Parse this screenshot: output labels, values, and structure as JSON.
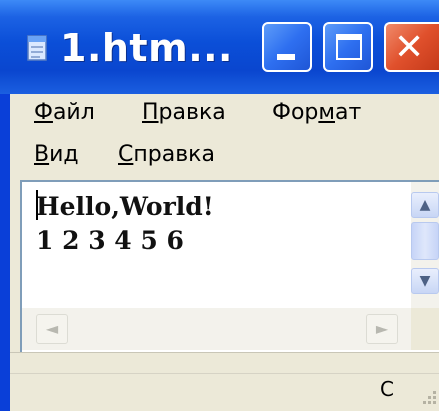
{
  "window": {
    "title": "1.htm...",
    "icon": "notepad-icon",
    "controls": {
      "minimize": "minimize-icon",
      "maximize": "maximize-icon",
      "close": "close-icon"
    }
  },
  "menu": {
    "items": [
      {
        "pre": "",
        "key": "Ф",
        "post": "айл"
      },
      {
        "pre": "",
        "key": "П",
        "post": "равка"
      },
      {
        "pre": "Фор",
        "key": "м",
        "post": "ат"
      },
      {
        "pre": "",
        "key": "В",
        "post": "ид"
      },
      {
        "pre": "",
        "key": "С",
        "post": "правка"
      }
    ]
  },
  "editor": {
    "lines": [
      "Hello,World!",
      "1 2 3 4 5 6"
    ]
  },
  "scrollbars": {
    "up": "▲",
    "down": "▼",
    "left": "◄",
    "right": "►"
  },
  "status": {
    "text": "С"
  },
  "colors": {
    "titlebar": "#0a4fd8",
    "close": "#e0502c",
    "chrome": "#ece9d8"
  }
}
